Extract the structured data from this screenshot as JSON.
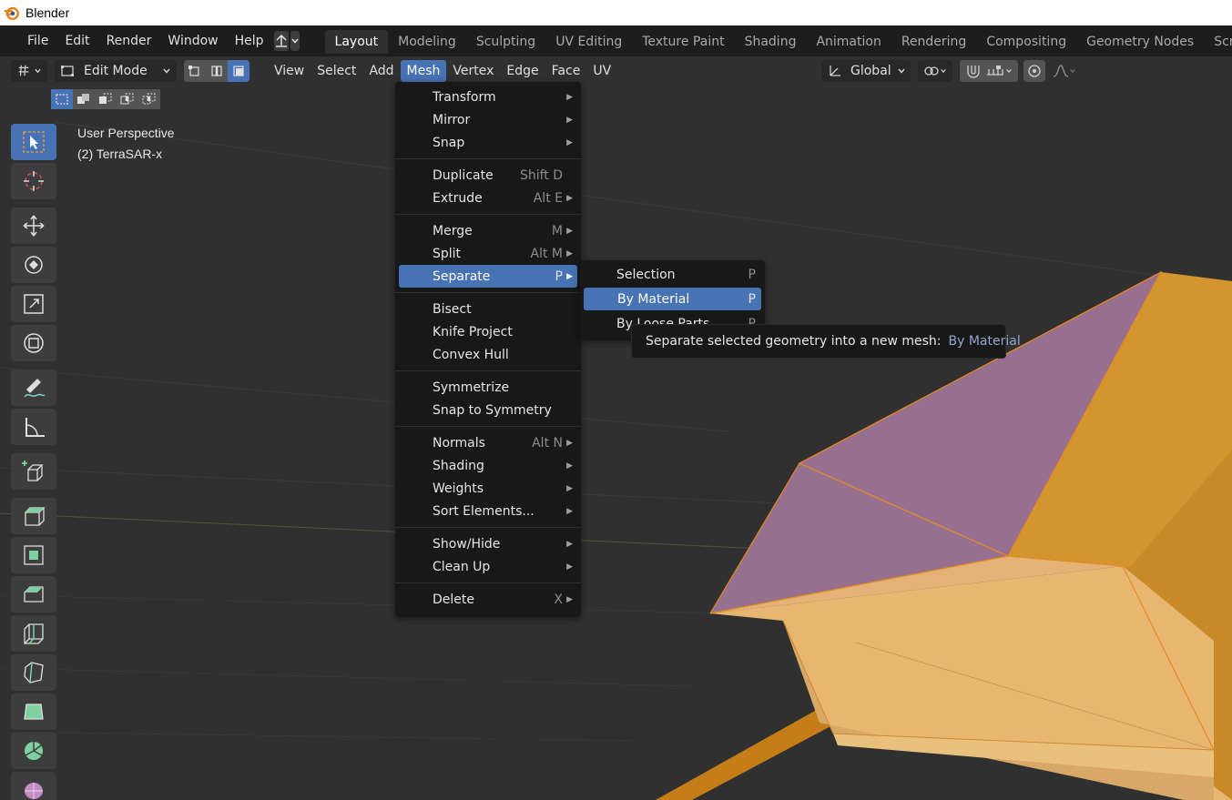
{
  "window": {
    "title": "Blender"
  },
  "topmenu": [
    "File",
    "Edit",
    "Render",
    "Window",
    "Help"
  ],
  "workspaces": [
    "Layout",
    "Modeling",
    "Sculpting",
    "UV Editing",
    "Texture Paint",
    "Shading",
    "Animation",
    "Rendering",
    "Compositing",
    "Geometry Nodes",
    "Scripting"
  ],
  "active_workspace": "Layout",
  "header": {
    "mode": "Edit Mode",
    "menus": [
      "View",
      "Select",
      "Add",
      "Mesh",
      "Vertex",
      "Edge",
      "Face",
      "UV"
    ],
    "open_menu": "Mesh",
    "orientation": "Global"
  },
  "viewport": {
    "perspective": "User Perspective",
    "object": "(2) TerraSAR-x"
  },
  "mesh_menu": {
    "groups": [
      [
        {
          "label": "Transform",
          "shortcut": "",
          "submenu": true
        },
        {
          "label": "Mirror",
          "shortcut": "",
          "submenu": true
        },
        {
          "label": "Snap",
          "shortcut": "",
          "submenu": true
        }
      ],
      [
        {
          "label": "Duplicate",
          "shortcut": "Shift D",
          "submenu": false
        },
        {
          "label": "Extrude",
          "shortcut": "Alt E",
          "submenu": true
        }
      ],
      [
        {
          "label": "Merge",
          "shortcut": "M",
          "submenu": true
        },
        {
          "label": "Split",
          "shortcut": "Alt M",
          "submenu": true
        },
        {
          "label": "Separate",
          "shortcut": "P",
          "submenu": true,
          "highlighted": true
        }
      ],
      [
        {
          "label": "Bisect",
          "shortcut": "",
          "submenu": false
        },
        {
          "label": "Knife Project",
          "shortcut": "",
          "submenu": false
        },
        {
          "label": "Convex Hull",
          "shortcut": "",
          "submenu": false
        }
      ],
      [
        {
          "label": "Symmetrize",
          "shortcut": "",
          "submenu": false
        },
        {
          "label": "Snap to Symmetry",
          "shortcut": "",
          "submenu": false
        }
      ],
      [
        {
          "label": "Normals",
          "shortcut": "Alt N",
          "submenu": true
        },
        {
          "label": "Shading",
          "shortcut": "",
          "submenu": true
        },
        {
          "label": "Weights",
          "shortcut": "",
          "submenu": true
        },
        {
          "label": "Sort Elements...",
          "shortcut": "",
          "submenu": true
        }
      ],
      [
        {
          "label": "Show/Hide",
          "shortcut": "",
          "submenu": true
        },
        {
          "label": "Clean Up",
          "shortcut": "",
          "submenu": true
        }
      ],
      [
        {
          "label": "Delete",
          "shortcut": "X",
          "submenu": true
        }
      ]
    ]
  },
  "separate_submenu": [
    {
      "label": "Selection",
      "shortcut": "P"
    },
    {
      "label": "By Material",
      "shortcut": "P",
      "highlighted": true
    },
    {
      "label": "By Loose Parts",
      "shortcut": "P"
    }
  ],
  "tooltip": {
    "text": "Separate selected geometry into a new mesh:",
    "value": "By Material"
  },
  "colors": {
    "accent": "#4772b3",
    "menu_bg": "#181818",
    "viewport_bg": "#303030",
    "mesh_orange": "#e8b060",
    "mesh_purple": "#9a7090"
  }
}
